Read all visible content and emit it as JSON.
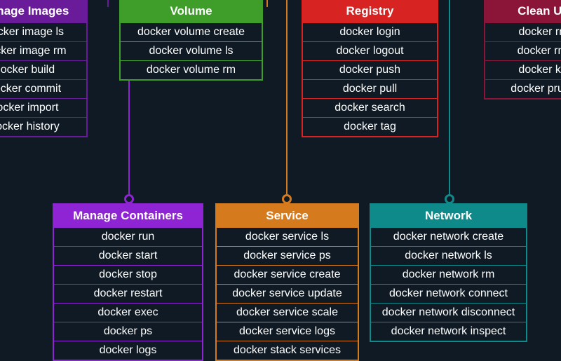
{
  "columns": {
    "manageImages": {
      "title": "Manage Images",
      "color": "#6a1b9a",
      "commands": [
        "docker image ls",
        "docker image rm",
        "docker build",
        "docker commit",
        "docker import",
        "docker history"
      ]
    },
    "volume": {
      "title": "Volume",
      "color": "#3f9e2a",
      "commands": [
        "docker volume create",
        "docker volume ls",
        "docker volume rm"
      ]
    },
    "registry": {
      "title": "Registry",
      "color": "#d82323",
      "commands": [
        "docker login",
        "docker logout",
        "docker push",
        "docker pull",
        "docker search",
        "docker tag"
      ]
    },
    "cleanUp": {
      "title": "Clean Up",
      "color": "#8a1538",
      "commands": [
        "docker rm",
        "docker rmi",
        "docker kill",
        "docker prune"
      ]
    },
    "manageContainers": {
      "title": "Manage Containers",
      "color": "#8e24d3",
      "commands": [
        "docker run",
        "docker start",
        "docker stop",
        "docker restart",
        "docker exec",
        "docker ps",
        "docker logs"
      ]
    },
    "service": {
      "title": "Service",
      "color": "#d67a1e",
      "commands": [
        "docker service ls",
        "docker service ps",
        "docker service create",
        "docker service update",
        "docker service scale",
        "docker service logs",
        "docker stack services"
      ]
    },
    "network": {
      "title": "Network",
      "color": "#0e8a8a",
      "commands": [
        "docker network create",
        "docker network ls",
        "docker network rm",
        "docker network connect",
        "docker network disconnect",
        "docker network inspect"
      ]
    }
  }
}
